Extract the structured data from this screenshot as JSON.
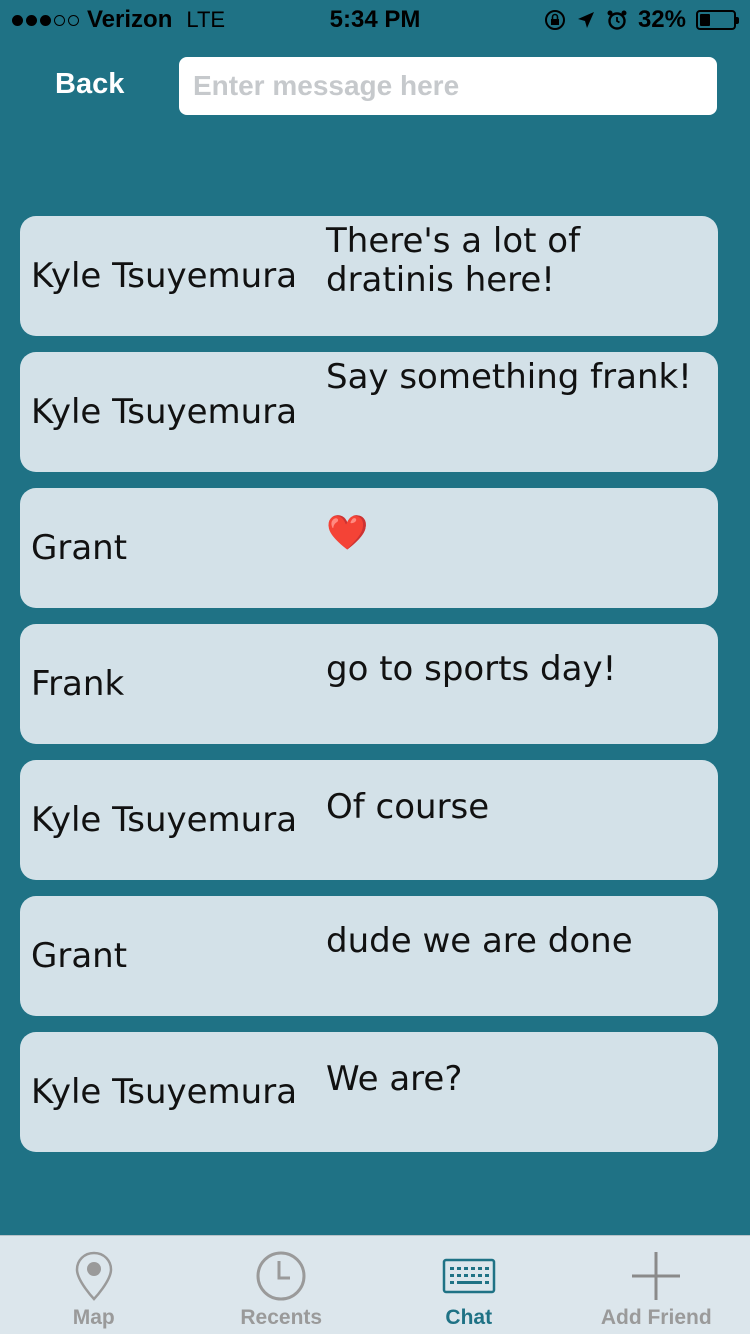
{
  "status_bar": {
    "carrier": "Verizon",
    "network": "LTE",
    "time": "5:34 PM",
    "battery_percent": "32%",
    "battery_level": 0.32,
    "signal_bars": 3,
    "signal_total": 5
  },
  "header": {
    "back_label": "Back",
    "input_placeholder": "Enter message here",
    "input_value": ""
  },
  "messages": [
    {
      "sender": "Kyle Tsuyemura",
      "text": "There's a lot of dratinis here!"
    },
    {
      "sender": "Kyle Tsuyemura",
      "text": "Say something frank!"
    },
    {
      "sender": "Grant",
      "text": "❤️"
    },
    {
      "sender": "Frank",
      "text": "go to sports day!"
    },
    {
      "sender": "Kyle Tsuyemura",
      "text": "Of course"
    },
    {
      "sender": "Grant",
      "text": "dude we are done"
    },
    {
      "sender": "Kyle Tsuyemura",
      "text": "We are?"
    }
  ],
  "tabs": [
    {
      "label": "Map",
      "icon": "map-pin-icon",
      "active": false
    },
    {
      "label": "Recents",
      "icon": "clock-icon",
      "active": false
    },
    {
      "label": "Chat",
      "icon": "keyboard-icon",
      "active": true
    },
    {
      "label": "Add Friend",
      "icon": "plus-icon",
      "active": false
    }
  ],
  "colors": {
    "background": "#1f7285",
    "card": "#d3e1e8",
    "tab_bar": "#dce6ec",
    "tab_active": "#1f7285",
    "tab_inactive": "#9a9a9a"
  }
}
